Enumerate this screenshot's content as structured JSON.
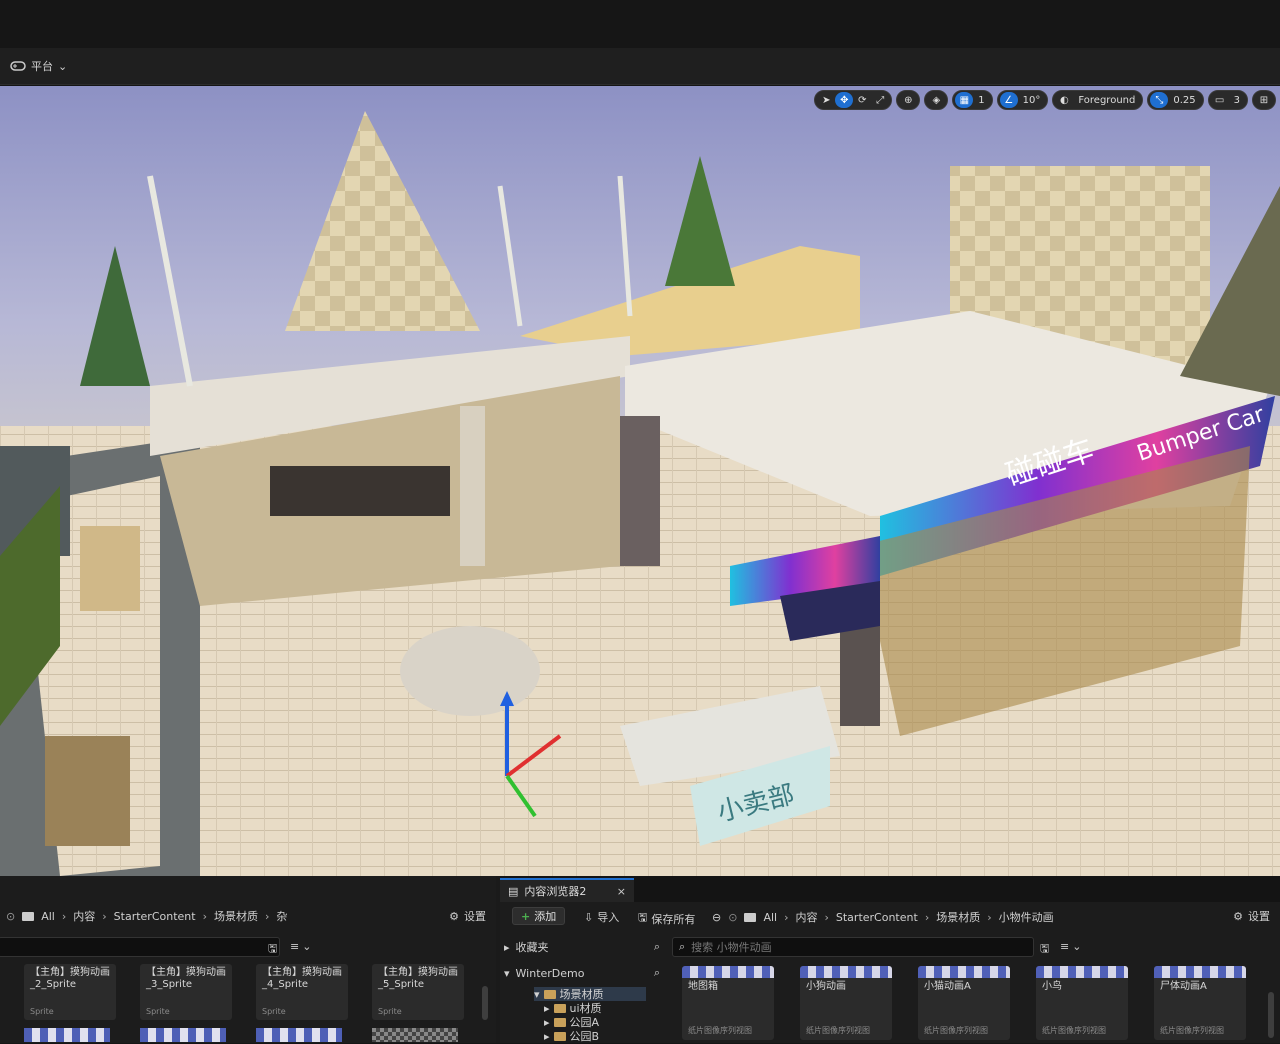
{
  "toolbar": {
    "platform_label": "平台"
  },
  "viewport_toolbar": {
    "grid_value": "1",
    "angle_value": "10°",
    "layer_label": "Foreground",
    "scale_value": "0.25",
    "camera_speed": "3"
  },
  "scene": {
    "sign_bumper_car_cn": "碰碰车",
    "sign_bumper_car_en": "Bumper Car",
    "sign_store": "小卖部"
  },
  "left_browser": {
    "breadcrumb": [
      "All",
      "内容",
      "StarterContent",
      "场景材质",
      "杂"
    ],
    "settings_label": "设置",
    "items": [
      {
        "name": "【主角】摸狗动画_2_Sprite",
        "type": "Sprite"
      },
      {
        "name": "【主角】摸狗动画_3_Sprite",
        "type": "Sprite"
      },
      {
        "name": "【主角】摸狗动画_4_Sprite",
        "type": "Sprite"
      },
      {
        "name": "【主角】摸狗动画_5_Sprite",
        "type": "Sprite"
      }
    ]
  },
  "right_browser": {
    "tab_label": "内容浏览器2",
    "add_label": "添加",
    "import_label": "导入",
    "save_all_label": "保存所有",
    "breadcrumb": [
      "All",
      "内容",
      "StarterContent",
      "场景材质",
      "小物件动画"
    ],
    "settings_label": "设置",
    "favorites_label": "收藏夹",
    "project_label": "WinterDemo",
    "tree": [
      "场景材质",
      "ui材质",
      "公园A",
      "公园B"
    ],
    "search_placeholder": "搜索 小物件动画",
    "items": [
      {
        "name": "地图箱",
        "type": "纸片图像序列视图"
      },
      {
        "name": "小狗动画",
        "type": "纸片图像序列视图"
      },
      {
        "name": "小猫动画A",
        "type": "纸片图像序列视图"
      },
      {
        "name": "小鸟",
        "type": "纸片图像序列视图"
      },
      {
        "name": "尸体动画A",
        "type": "纸片图像序列视图"
      }
    ]
  }
}
